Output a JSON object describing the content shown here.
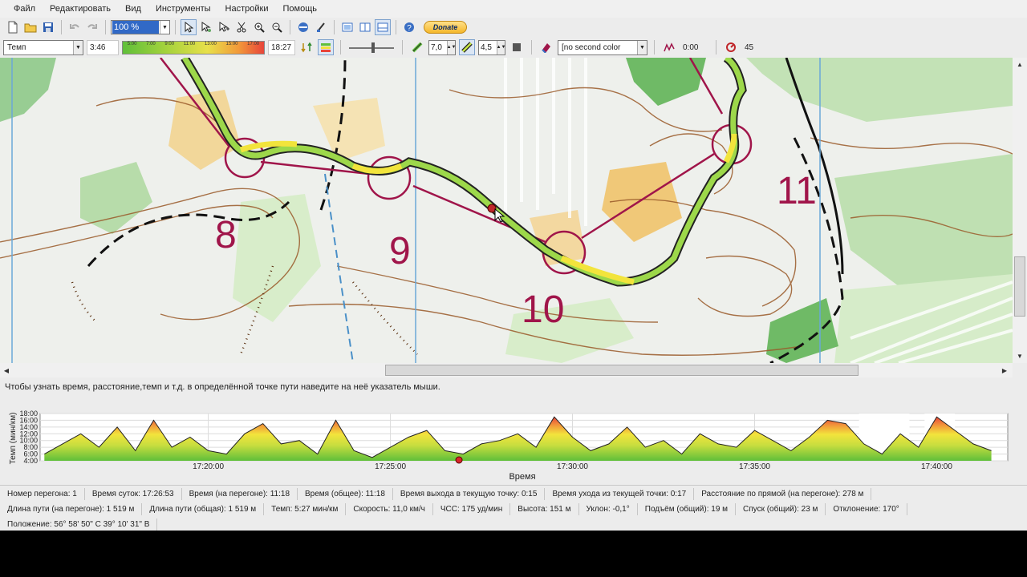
{
  "menu": [
    "Файл",
    "Редактировать",
    "Вид",
    "Инструменты",
    "Настройки",
    "Помощь"
  ],
  "toolbar": {
    "zoom_value": "100 %",
    "donate_label": "Donate"
  },
  "toolbar2": {
    "mode_select": "Темп",
    "time_min": "3:46",
    "scale_ticks": [
      "5:00",
      "7:00",
      "9:00",
      "11:00",
      "13:00",
      "15:00",
      "17:00"
    ],
    "time_max": "18:27",
    "line_width": "7,0",
    "line_opacity": "4,5",
    "second_color": "[no second color",
    "time_offset": "0:00",
    "smoothing": "45"
  },
  "map": {
    "control_labels": [
      "8",
      "9",
      "10",
      "11"
    ]
  },
  "hint": "Чтобы узнать время, расстояние,темп и т.д. в определённой точке пути наведите на неё указатель мыши.",
  "chart_data": {
    "type": "line",
    "ylabel": "Темп (мин/км)",
    "xlabel": "Время",
    "y_ticks": [
      "18:00",
      "16:00",
      "14:00",
      "12:00",
      "10:00",
      "8:00",
      "6:00",
      "4:00"
    ],
    "ylim": [
      4,
      18
    ],
    "x_ticks": [
      "17:20:00",
      "17:25:00",
      "17:30:00",
      "17:35:00",
      "17:40:00"
    ],
    "x_range": [
      "17:15:23",
      "17:41:57"
    ],
    "x": [
      "17:15:30",
      "17:16:00",
      "17:16:30",
      "17:17:00",
      "17:17:30",
      "17:18:00",
      "17:18:30",
      "17:19:00",
      "17:19:30",
      "17:20:00",
      "17:20:30",
      "17:21:00",
      "17:21:30",
      "17:22:00",
      "17:22:30",
      "17:23:00",
      "17:23:30",
      "17:24:00",
      "17:24:30",
      "17:25:00",
      "17:25:30",
      "17:26:00",
      "17:26:30",
      "17:27:00",
      "17:27:30",
      "17:28:00",
      "17:28:30",
      "17:29:00",
      "17:29:30",
      "17:30:00",
      "17:30:30",
      "17:31:00",
      "17:31:30",
      "17:32:00",
      "17:32:30",
      "17:33:00",
      "17:33:30",
      "17:34:00",
      "17:34:30",
      "17:35:00",
      "17:35:30",
      "17:36:00",
      "17:36:30",
      "17:37:00",
      "17:37:30",
      "17:38:00",
      "17:38:30",
      "17:39:00",
      "17:39:30",
      "17:40:00",
      "17:40:30",
      "17:41:00",
      "17:41:30"
    ],
    "series": [
      {
        "values": [
          6,
          9,
          12,
          8,
          14,
          7,
          16,
          8,
          11,
          7,
          6,
          12,
          15,
          9,
          10,
          6,
          16,
          7,
          5,
          8,
          11,
          13,
          7,
          6,
          9,
          10,
          12,
          8,
          17,
          11,
          7,
          9,
          14,
          8,
          10,
          6,
          12,
          9,
          8,
          13,
          10,
          7,
          11,
          16,
          15,
          9,
          6,
          12,
          8,
          17,
          13,
          9,
          7
        ]
      }
    ],
    "current_marker": "17:26:53",
    "gaps": [
      [
        "17:37:52",
        "17:39:15"
      ],
      [
        "17:39:40",
        "17:40:30"
      ]
    ]
  },
  "status": {
    "row1": [
      "Номер перегона: 1",
      "Время суток: 17:26:53",
      "Время (на перегоне): 11:18",
      "Время (общее): 11:18",
      "Время выхода в текущую точку: 0:15",
      "Время ухода из текущей точки: 0:17",
      "Расстояние по прямой (на перегоне): 278 м"
    ],
    "row2": [
      "Длина пути (на перегоне): 1 519 м",
      "Длина пути (общая): 1 519 м",
      "Темп: 5:27 мин/км",
      "Скорость: 11,0 км/ч",
      "ЧСС: 175 уд/мин",
      "Высота: 151 м",
      "Уклон: -0,1°",
      "Подъём (общий): 19 м",
      "Спуск (общий): 23 м",
      "Отклонение: 170°"
    ],
    "row3": [
      "Положение: 56° 58' 50\" С  39° 10' 31\" В"
    ]
  },
  "colors": {
    "route_green": "#9dd84a",
    "route_yellow": "#f2e43c",
    "course_purple": "#a0154a",
    "map_bg": "#eef0ec"
  }
}
